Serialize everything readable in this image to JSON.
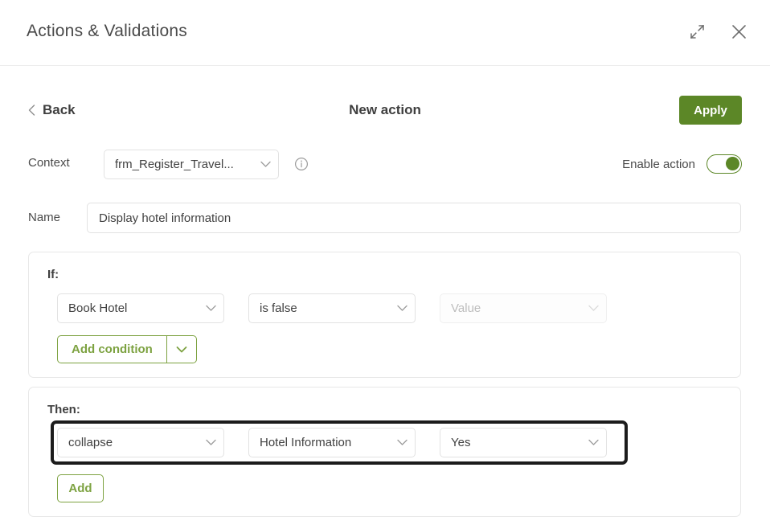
{
  "window": {
    "title": "Actions & Validations",
    "expand_icon": "expand-arrows-icon",
    "close_icon": "close-icon"
  },
  "nav": {
    "back_label": "Back",
    "back_icon": "chevron-left-icon",
    "page_title": "New action",
    "apply_label": "Apply"
  },
  "context": {
    "label": "Context",
    "value": "frm_Register_Travel...",
    "info_icon": "info-icon",
    "enable_label": "Enable action",
    "enable_state": "on"
  },
  "name": {
    "label": "Name",
    "value": "Display hotel information",
    "placeholder": "Name"
  },
  "if_section": {
    "heading": "If:",
    "condition": {
      "field": "Book Hotel",
      "operator": "is false",
      "value_placeholder": "Value",
      "value": ""
    },
    "add_condition_label": "Add condition",
    "add_condition_arrow_icon": "chevron-down-icon"
  },
  "then_section": {
    "heading": "Then:",
    "action": {
      "operation": "collapse",
      "target": "Hotel Information",
      "value": "Yes"
    },
    "add_label": "Add"
  },
  "colors": {
    "accent_green": "#5c8727",
    "outline_green": "#7da241",
    "border_gray": "#e2e2e2",
    "highlight_black": "#1c1c1c",
    "text_dark": "#3f3f3f",
    "placeholder_gray": "#bdbdbd"
  }
}
